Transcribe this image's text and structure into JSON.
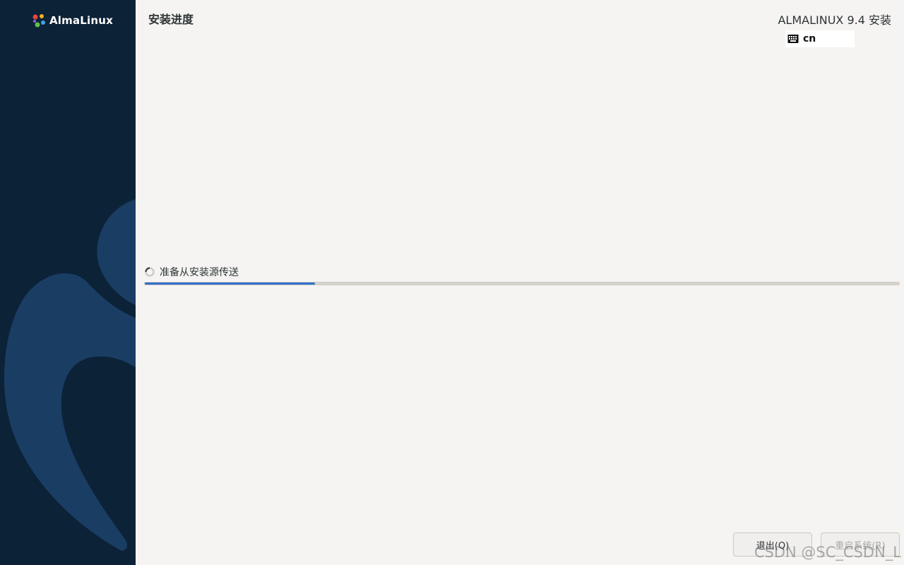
{
  "sidebar": {
    "logo_text": "AlmaLinux"
  },
  "header": {
    "page_title": "安装进度",
    "product_title": "ALMALINUX 9.4 安装",
    "keyboard_layout": "cn"
  },
  "progress": {
    "status_text": "准备从安装源传送",
    "value": 0.226
  },
  "buttons": {
    "quit_label": "退出(Q)",
    "reboot_label": "重启系统(R)"
  },
  "watermark": "CSDN @SC_CSDN_L",
  "colors": {
    "sidebar_bg": "#0c2236",
    "sidebar_art": "#1a3d64",
    "progress_fill": "#2f6fc8",
    "main_bg": "#f5f4f2"
  },
  "icons": {
    "logo": "almalinux-logo-icon",
    "keyboard": "keyboard-icon",
    "status": "spinner-icon"
  }
}
